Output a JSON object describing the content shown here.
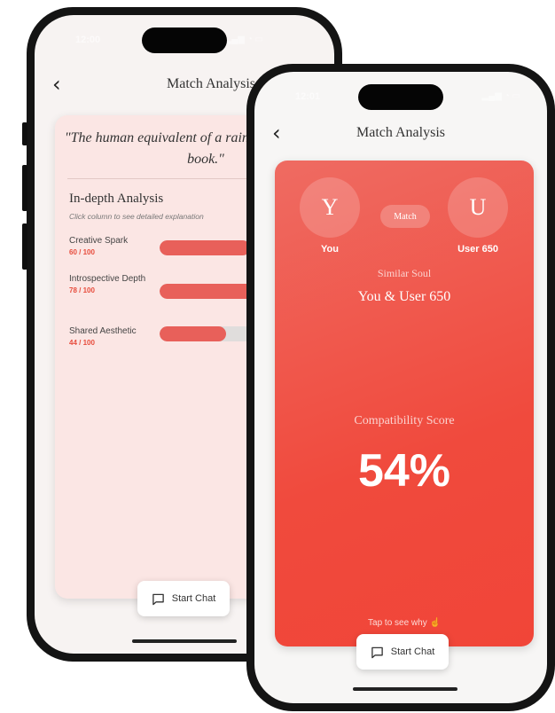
{
  "back_screen": {
    "status_time": "12:00",
    "nav_title": "Match Analysis",
    "quote": "\"The human equivalent of a rainy day and a good book.\"",
    "section_title": "In-depth Analysis",
    "section_subtitle": "Click column to see detailed explanation",
    "metrics": [
      {
        "label": "Creative Spark",
        "score_text": "60 / 100",
        "value": 60
      },
      {
        "label": "Introspective Depth",
        "score_text": "78 / 100",
        "value": 78
      },
      {
        "label": "Shared Aesthetic",
        "score_text": "44 / 100",
        "value": 44
      }
    ],
    "chat_button": "Start Chat"
  },
  "front_screen": {
    "status_time": "12:01",
    "nav_title": "Match Analysis",
    "user_initial": "Y",
    "user_name": "You",
    "match_label": "Match",
    "partner_initial": "U",
    "partner_name": "User 650",
    "soul_type": "Similar Soul",
    "pair_text": "You & User 650",
    "compat_label": "Compatibility Score",
    "compat_score": "54%",
    "tap_hint": "Tap to see why",
    "chat_button": "Start Chat"
  },
  "colors": {
    "accent": "#e8605a",
    "card_red": "#f04a3d",
    "score_red": "#e74c3c"
  }
}
